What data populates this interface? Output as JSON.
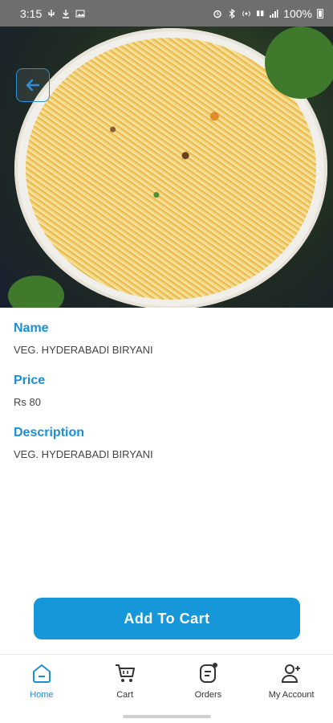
{
  "status_bar": {
    "time": "3:15",
    "battery": "100%"
  },
  "product": {
    "name_label": "Name",
    "name_value": "VEG. HYDERABADI BIRYANI",
    "price_label": "Price",
    "price_value": "Rs 80",
    "description_label": "Description",
    "description_value": "VEG. HYDERABADI BIRYANI"
  },
  "actions": {
    "add_to_cart": "Add To Cart"
  },
  "nav": {
    "items": [
      {
        "label": "Home",
        "icon": "home-icon",
        "active": true
      },
      {
        "label": "Cart",
        "icon": "cart-icon",
        "active": false
      },
      {
        "label": "Orders",
        "icon": "orders-icon",
        "active": false
      },
      {
        "label": "My Account",
        "icon": "account-icon",
        "active": false
      }
    ]
  },
  "colors": {
    "accent": "#1597da",
    "status_bar": "#6e6e6e"
  }
}
